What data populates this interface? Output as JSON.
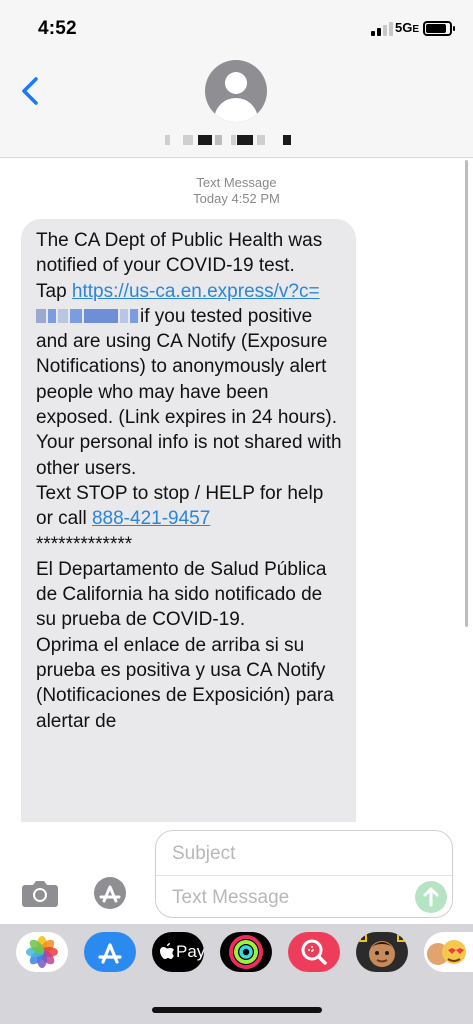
{
  "status_bar": {
    "time": "4:52",
    "network": "5G",
    "network_suffix": "E",
    "signal_bars_active": 2,
    "battery_level": 0.85
  },
  "header": {
    "back_icon": "chevron-left-icon",
    "avatar_icon": "person-silhouette-icon",
    "accent_color": "#1a7cf2"
  },
  "thread": {
    "message_type": "Text Message",
    "timestamp": "Today 4:52 PM",
    "message": {
      "p1": "The CA Dept of Public Health was notified of your COVID-19 test.",
      "tap": "Tap ",
      "link": "https://us-ca.en.express/v?c=",
      "link_after": "if you tested positive and are using CA Notify (Exposure Notifications) to anonymously alert people who may have been exposed. (Link expires in 24 hours).",
      "p3": "Your personal info is not shared with other users.",
      "p4_before": "Text STOP to stop / HELP for help or call ",
      "phone": "888-421-9457",
      "separator": "*************",
      "es1": "El Departamento de Salud Pública de California ha sido notificado de su prueba de COVID-19.",
      "es2": "Oprima el enlace de arriba si su prueba es positiva y usa CA Notify (Notificaciones de Exposición) para alertar de"
    },
    "link_color": "#2a86d8",
    "bubble_color": "#e9e9eb"
  },
  "composer": {
    "subject_placeholder": "Subject",
    "message_placeholder": "Text Message",
    "camera_icon": "camera-icon",
    "appstore_icon": "app-store-icon",
    "send_icon": "send-arrow-up-icon"
  },
  "tray": {
    "apps": [
      {
        "name": "photos-app-icon"
      },
      {
        "name": "app-store-app-icon"
      },
      {
        "name": "apple-pay-app-icon",
        "label": "Pay"
      },
      {
        "name": "activity-app-icon"
      },
      {
        "name": "images-search-app-icon"
      },
      {
        "name": "memoji-app-icon"
      },
      {
        "name": "animoji-stickers-app-icon"
      }
    ]
  }
}
